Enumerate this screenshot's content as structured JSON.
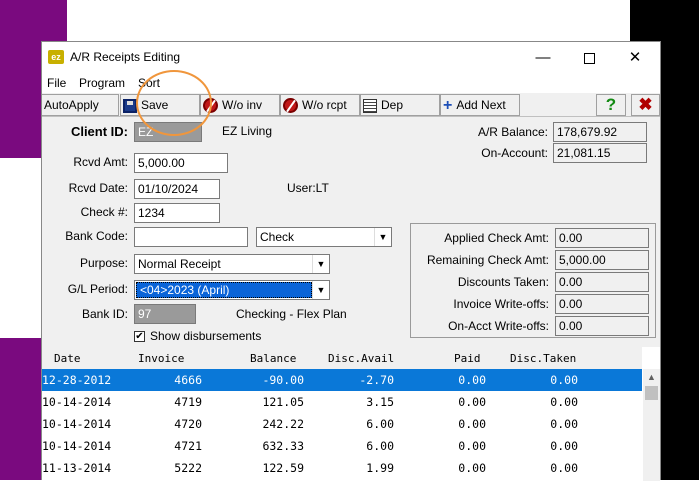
{
  "window": {
    "title": "A/R Receipts Editing",
    "app_icon": "ez",
    "buttons": {
      "minimize": "—",
      "close": "✕"
    }
  },
  "menu": [
    "File",
    "Program",
    "Sort"
  ],
  "toolbar": {
    "autoapply": "AutoApply",
    "save": "Save",
    "wo_inv": "W/o inv",
    "wo_rcpt": "W/o rcpt",
    "dep": "Dep",
    "add_next": "Add Next",
    "help_icon": "?",
    "close_icon": "✖"
  },
  "form": {
    "client_id_label": "Client ID:",
    "client_id": "EZ",
    "client_name": "EZ Living",
    "rcvd_amt_label": "Rcvd Amt:",
    "rcvd_amt": "5,000.00",
    "rcvd_date_label": "Rcvd Date:",
    "rcvd_date": "01/10/2024",
    "user": "User:LT",
    "check_label": "Check #:",
    "check_no": "1234",
    "bank_code_label": "Bank Code:",
    "bank_code": "",
    "payment_type": "Check",
    "purpose_label": "Purpose:",
    "purpose": "Normal Receipt",
    "gl_period_label": "G/L Period:",
    "gl_period": "<04>2023 (April)",
    "bank_id_label": "Bank ID:",
    "bank_id": "97",
    "bank_name": "Checking - Flex Plan",
    "show_disbursements": "Show disbursements",
    "show_disbursements_checked": true
  },
  "balances": {
    "ar_balance_label": "A/R Balance:",
    "ar_balance": "178,679.92",
    "on_account_label": "On-Account:",
    "on_account": "21,081.15"
  },
  "summary": {
    "applied_label": "Applied Check Amt:",
    "applied": "0.00",
    "remaining_label": "Remaining Check Amt:",
    "remaining": "5,000.00",
    "discounts_label": "Discounts Taken:",
    "discounts": "0.00",
    "inv_wo_label": "Invoice Write-offs:",
    "inv_wo": "0.00",
    "acct_wo_label": "On-Acct Write-offs:",
    "acct_wo": "0.00"
  },
  "grid": {
    "columns": [
      "Date",
      "Invoice",
      "Balance",
      "Disc.Avail",
      "Paid",
      "Disc.Taken"
    ],
    "rows": [
      [
        "12-28-2012",
        "4666",
        "-90.00",
        "-2.70",
        "0.00",
        "0.00"
      ],
      [
        "10-14-2014",
        "4719",
        "121.05",
        "3.15",
        "0.00",
        "0.00"
      ],
      [
        "10-14-2014",
        "4720",
        "242.22",
        "6.00",
        "0.00",
        "0.00"
      ],
      [
        "10-14-2014",
        "4721",
        "632.33",
        "6.00",
        "0.00",
        "0.00"
      ],
      [
        "11-13-2014",
        "5222",
        "122.59",
        "1.99",
        "0.00",
        "0.00"
      ]
    ],
    "selected_row": 0
  },
  "colors": {
    "accent_selection": "#0a78d8",
    "desktop_purple": "#7a0a7f",
    "highlight_circle": "#f0963c"
  }
}
